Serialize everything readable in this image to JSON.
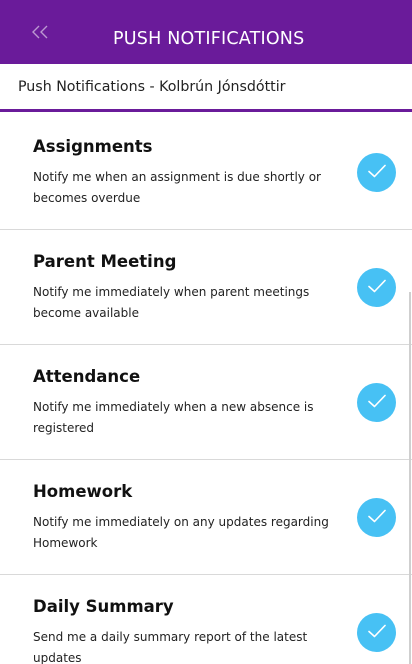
{
  "header": {
    "back_icon": "double-chevron-left-icon",
    "title": "PUSH NOTIFICATIONS",
    "bar_color": "#6a1b9a"
  },
  "subheader": {
    "text": "Push Notifications  -  Kolbrún Jónsdóttir",
    "accent_color": "#6a1b9a"
  },
  "settings": [
    {
      "title": "Assignments",
      "description": "Notify me when an assignment is due shortly or becomes overdue",
      "checked": true
    },
    {
      "title": "Parent Meeting",
      "description": "Notify me immediately when parent meetings become available",
      "checked": true
    },
    {
      "title": "Attendance",
      "description": "Notify me immediately when a new absence is registered",
      "checked": true
    },
    {
      "title": "Homework",
      "description": "Notify me immediately on any updates regarding Homework",
      "checked": true
    },
    {
      "title": "Daily Summary",
      "description": "Send me a daily summary report of the latest updates",
      "checked": true
    }
  ],
  "check_color": "#47c1f4",
  "check_icon": "checkmark-icon"
}
